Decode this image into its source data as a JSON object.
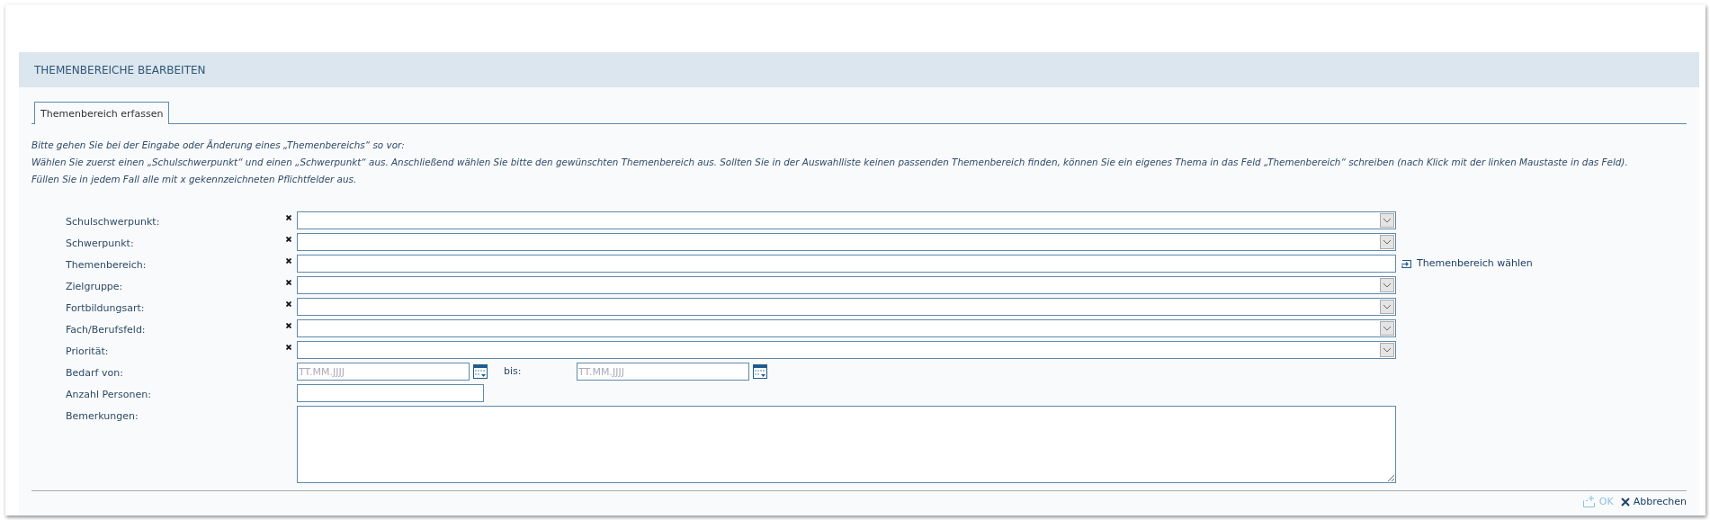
{
  "dialog": {
    "title": "THEMENBEREICHE BEARBEITEN"
  },
  "tabs": [
    {
      "label": "Themenbereich erfassen",
      "selected": true
    }
  ],
  "instructions": [
    "Bitte gehen Sie bei der Eingabe oder Änderung eines „Themenbereichs“ so vor:",
    "Wählen Sie zuerst einen „Schulschwerpunkt“ und einen „Schwerpunkt“ aus. Anschließend wählen Sie bitte den gewünschten Themenbereich aus. Sollten Sie in der Auswahlliste keinen passenden Themenbereich finden, können Sie ein eigenes Thema in das Feld „Themenbereich“ schreiben (nach Klick mit der linken Maustaste in das Feld).",
    "Füllen Sie in jedem Fall alle mit x gekennzeichneten Pflichtfelder aus."
  ],
  "fields": [
    {
      "kind": "select",
      "label": "Schulschwerpunkt:",
      "required": true
    },
    {
      "kind": "select",
      "label": "Schwerpunkt:",
      "required": true
    },
    {
      "kind": "text",
      "label": "Themenbereich:",
      "required": true,
      "link": "Themenbereich wählen"
    },
    {
      "kind": "select",
      "label": "Zielgruppe:",
      "required": true
    },
    {
      "kind": "select",
      "label": "Fortbildungsart:",
      "required": true
    },
    {
      "kind": "select",
      "label": "Fach/Berufsfeld:",
      "required": true
    },
    {
      "kind": "select",
      "label": "Priorität:",
      "required": true
    },
    {
      "kind": "daterange",
      "label": "Bedarf von:",
      "required": false,
      "placeholder": "TT.MM.JJJJ",
      "to_label": "bis:",
      "to_placeholder": "TT.MM.JJJJ"
    },
    {
      "kind": "short",
      "label": "Anzahl Personen:",
      "required": false
    },
    {
      "kind": "textarea",
      "label": "Bemerkungen:",
      "required": false
    }
  ],
  "buttons": [
    {
      "kind": "ok",
      "label": "OK",
      "disabled": true
    },
    {
      "kind": "cancel",
      "label": "Abbrechen",
      "disabled": false
    }
  ]
}
